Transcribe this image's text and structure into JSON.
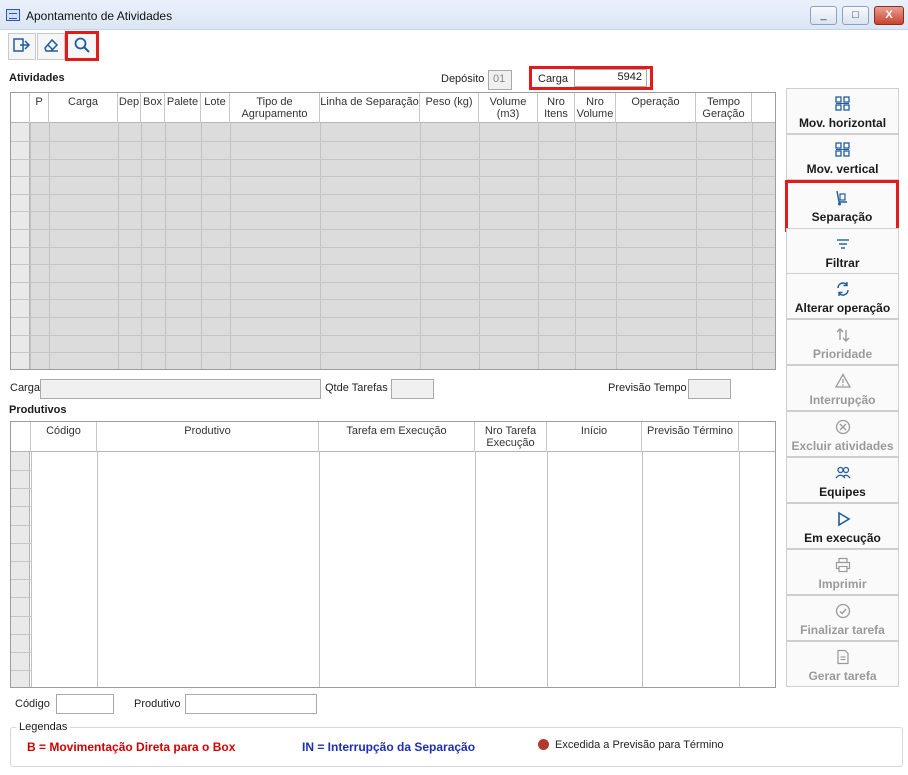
{
  "window": {
    "title": "Apontamento de Atividades",
    "min_label": "_",
    "max_label": "□",
    "close_label": "X"
  },
  "toolbar": {
    "icons": [
      "exit-icon",
      "eraser-icon",
      "search-icon"
    ]
  },
  "atividades": {
    "section_label": "Atividades",
    "deposito_label": "Depósito",
    "deposito_value": "01",
    "carga_label": "Carga",
    "carga_value": "5942",
    "columns": [
      "",
      "P",
      "Carga",
      "Dep",
      "Box",
      "Palete",
      "Lote",
      "Tipo de Agrupamento",
      "Linha de Separação",
      "Peso (kg)",
      "Volume (m3)",
      "Nro Itens",
      "Nro Volume",
      "Operação",
      "Tempo Geração"
    ]
  },
  "carga_filter": {
    "carga_label": "Carga",
    "carga_value": "",
    "qtde_tarefas_label": "Qtde Tarefas",
    "qtde_tarefas_value": "",
    "previsao_tempo_label": "Previsão Tempo",
    "previsao_tempo_value": ""
  },
  "produtivos": {
    "section_label": "Produtivos",
    "columns": [
      "",
      "Código",
      "Produtivo",
      "Tarefa em Execução",
      "Nro Tarefa Execução",
      "Início",
      "Previsão Término",
      ""
    ],
    "codigo_label": "Código",
    "codigo_value": "",
    "produtivo_label": "Produtivo",
    "produtivo_value": ""
  },
  "right_panel": {
    "buttons": [
      {
        "label": "Mov. horizontal",
        "icon": "grid-icon",
        "enabled": true
      },
      {
        "label": "Mov. vertical",
        "icon": "grid-icon",
        "enabled": true
      },
      {
        "label": "Separação",
        "icon": "hand-truck-icon",
        "enabled": true
      },
      {
        "label": "Filtrar",
        "icon": "filter-icon",
        "enabled": true
      },
      {
        "label": "Alterar operação",
        "icon": "refresh-icon",
        "enabled": true
      },
      {
        "label": "Prioridade",
        "icon": "sort-arrows-icon",
        "enabled": false
      },
      {
        "label": "Interrupção",
        "icon": "warning-icon",
        "enabled": false
      },
      {
        "label": "Excluir atividades",
        "icon": "delete-circle-icon",
        "enabled": false
      },
      {
        "label": "Equipes",
        "icon": "team-icon",
        "enabled": true
      },
      {
        "label": "Em execução",
        "icon": "play-icon",
        "enabled": true
      },
      {
        "label": "Imprimir",
        "icon": "printer-icon",
        "enabled": false
      },
      {
        "label": "Finalizar tarefa",
        "icon": "check-circle-icon",
        "enabled": false
      },
      {
        "label": "Gerar tarefa",
        "icon": "document-icon",
        "enabled": false
      }
    ]
  },
  "legend": {
    "title": "Legendas",
    "items": [
      {
        "text": "B = Movimentação Direta para o Box",
        "color": "#d40000"
      },
      {
        "text": "IN = Interrupção da Separação",
        "color": "#1c2fb0"
      },
      {
        "text": "Excedida a Previsão para Término",
        "color": "#222222"
      }
    ],
    "dot_color": "#b3392e"
  }
}
